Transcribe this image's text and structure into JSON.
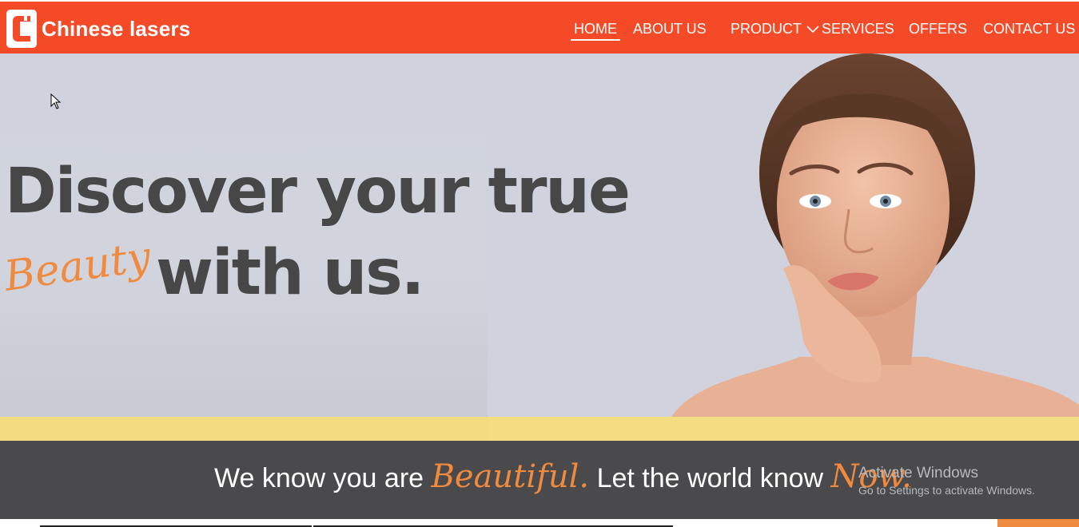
{
  "header": {
    "brand": "Chinese lasers",
    "nav": [
      {
        "label": "HOME"
      },
      {
        "label": "ABOUT US"
      },
      {
        "label": "PRODUCT"
      },
      {
        "label": "SERVICES"
      },
      {
        "label": "OFFERS"
      },
      {
        "label": "CONTACT US"
      }
    ]
  },
  "hero": {
    "line1": "Discover your true",
    "script_word": "Beauty",
    "line2": "with us."
  },
  "tagline": {
    "part1": "We know you are",
    "script1": "Beautiful.",
    "part2": "Let the world know",
    "script2": "Now."
  },
  "watermark": {
    "title": "Activate Windows",
    "subtitle": "Go to Settings to activate Windows."
  },
  "colors": {
    "header": "#f54a27",
    "accent": "#f08a3e",
    "band": "#f5dd82",
    "tagbar": "#4a4a4c",
    "heading": "#474747"
  }
}
